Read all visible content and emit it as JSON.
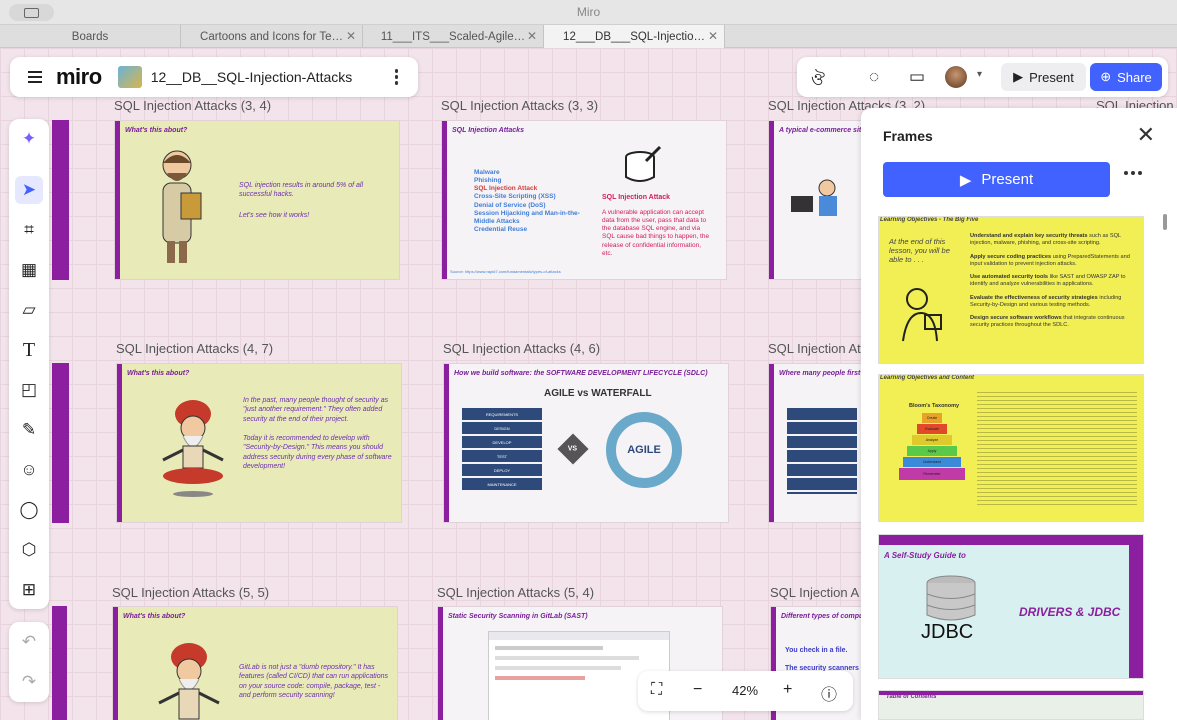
{
  "window": {
    "title": "Miro"
  },
  "tabs": [
    {
      "label": "Boards"
    },
    {
      "label": "Cartoons and Icons for Te…"
    },
    {
      "label": "11___ITS___Scaled-Agile…"
    },
    {
      "label": "12___DB___SQL-Injectio…"
    }
  ],
  "menu": {
    "logo": "miro",
    "board_name": "12__DB__SQL-Injection-Attacks"
  },
  "topbar": {
    "present_label": "Present",
    "share_label": "Share"
  },
  "frames_row1": [
    {
      "title": "SQL Injection Attacks (3, 4)",
      "header": "What's this about?",
      "text1": "SQL injection results in around 5% of all successful hacks.",
      "text2": "Let's see how it works!"
    },
    {
      "title": "SQL Injection Attacks (3, 3)",
      "header": "SQL Injection Attacks",
      "list": [
        "Malware",
        "Phishing",
        "SQL Injection Attack",
        "Cross-Site Scripting (XSS)",
        "Denial of Service (DoS)",
        "Session Hijacking and Man-in-the-Middle Attacks",
        "Credential Reuse"
      ],
      "heading": "SQL Injection Attack",
      "body": "A vulnerable application can accept data from the user, pass that data to the database SQL engine, and via SQL cause bad things to happen, the release of confidential information, etc.",
      "source": "Source: https://www.rapid7.com/fundamentals/types-of-attacks"
    },
    {
      "title": "SQL Injection Attacks (3, 2)",
      "header": "A typical e-commerce site"
    }
  ],
  "frames_row2": [
    {
      "title": "SQL Injection Attacks (4, 7)",
      "header": "What's this about?",
      "text1": "In the past, many people thought of security as \"just another requirement.\" They often added security at the end of their project.",
      "text2": "Today it is recommended to develop with \"Security-by-Design.\" This means you should address security during every phase of software development!"
    },
    {
      "title": "SQL Injection Attacks (4, 6)",
      "header": "How we build software: the SOFTWARE DEVELOPMENT LIFECYCLE (SDLC)",
      "graphic_title": "AGILE vs WATERFALL",
      "agile": "AGILE",
      "vs": "VS",
      "waterfall_steps": [
        "REQUIREMENTS",
        "DESIGN",
        "DEVELOP",
        "TEST",
        "DEPLOY",
        "MAINTENANCE"
      ]
    },
    {
      "title": "SQL Injection At",
      "header": "Where many people first t"
    }
  ],
  "frames_row3": [
    {
      "title": "SQL Injection Attacks (5, 5)",
      "header": "What's this about?",
      "text1": "GitLab is not just a \"dumb repository.\" It has features (called CI/CD) that can run applications on your source code: compile, package, test - and perform security scanning!"
    },
    {
      "title": "SQL Injection Attacks (5, 4)",
      "header": "Static Security Scanning in GitLab (SAST)"
    },
    {
      "title": "SQL Injection A",
      "header": "Different types of compu",
      "line1": "You check in a file.",
      "line2": "The security scanners sca"
    }
  ],
  "extra_label": "SQL Injection",
  "panel": {
    "title": "Frames",
    "present_label": "Present",
    "thumb1": {
      "header": "Learning Objectives - The Big Five",
      "aside": "At the end of this lesson, you will be able to . . .",
      "items": [
        {
          "bold": "Understand and explain key security threats",
          "rest": " such as SQL injection, malware, phishing, and cross-site scripting."
        },
        {
          "bold": "Apply secure coding practices",
          "rest": " using PreparedStatements and input validation to prevent injection attacks."
        },
        {
          "bold": "Use automated security tools",
          "rest": " like SAST and OWASP ZAP to identify and analyze vulnerabilities in applications."
        },
        {
          "bold": "Evaluate the effectiveness of security strategies",
          "rest": " including Security-by-Design and various testing methods."
        },
        {
          "bold": "Design secure software workflows",
          "rest": " that integrate continuous security practices throughout the SDLC."
        }
      ]
    },
    "thumb2": {
      "header": "Learning Objectives and Content",
      "taxonomy": "Bloom's Taxonomy",
      "levels": [
        "Create",
        "Evaluate",
        "Analyze",
        "Apply",
        "Understand",
        "Remember"
      ]
    },
    "thumb3": {
      "header": "A Self-Study Guide to",
      "jdbc": "JDBC",
      "title": "DRIVERS & JDBC"
    },
    "thumb4": {
      "header": "Table of Contents"
    }
  },
  "zoom": {
    "level": "42%"
  }
}
